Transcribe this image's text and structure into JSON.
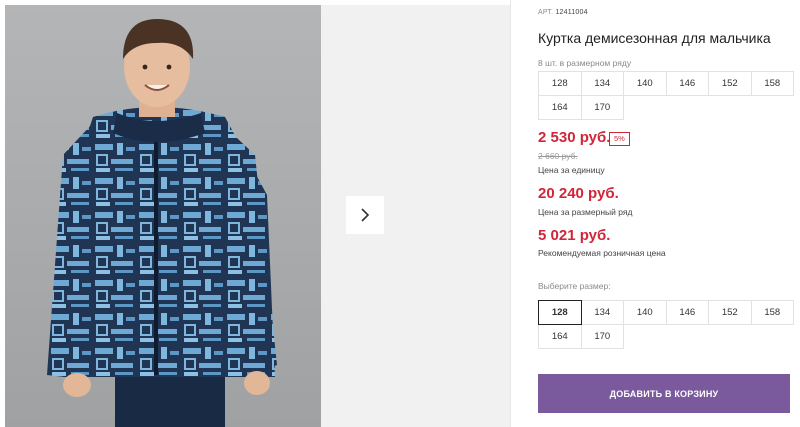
{
  "gallery": {
    "photo_icon": "boy-in-patterned-jacket-photo",
    "next_icon": "chevron-right-icon"
  },
  "product": {
    "sku_label": "АРТ.",
    "sku_value": "12411004",
    "title": "Куртка демисезонная для мальчика",
    "count_note": "8 шт. в размерном ряду",
    "size_row_sizes": [
      "128",
      "134",
      "140",
      "146",
      "152",
      "158",
      "164",
      "170"
    ],
    "price_unit": "2 530 руб.",
    "discount": "5%",
    "price_old": "2 660 руб.",
    "price_unit_label": "Цена за единицу",
    "price_row": "20 240 руб.",
    "price_row_label": "Цена за размерный ряд",
    "price_retail": "5 021 руб.",
    "price_retail_label": "Рекомендуемая розничная цена",
    "choose_label": "Выберите размер:",
    "choose_sizes": [
      "128",
      "134",
      "140",
      "146",
      "152",
      "158",
      "164",
      "170"
    ],
    "selected_size": "128",
    "add_to_cart": "ДОБАВИТЬ В КОРЗИНУ"
  },
  "colors": {
    "price_red": "#d0263a",
    "button_purple": "#7a5a9c",
    "jacket_navy": "#1f3553",
    "jacket_print": "#6ea9d6"
  }
}
